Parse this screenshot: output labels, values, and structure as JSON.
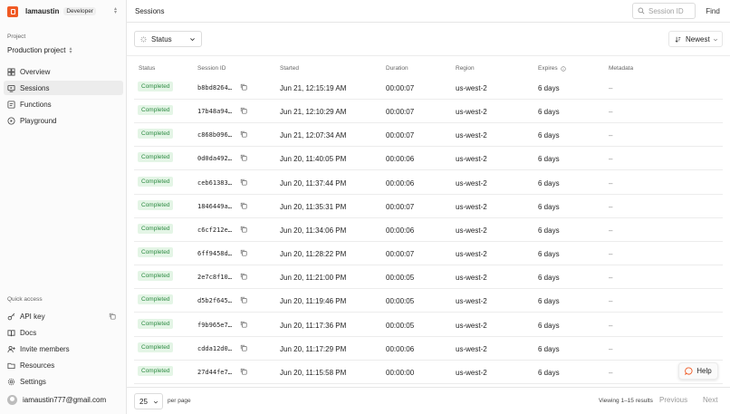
{
  "app": {
    "org_name": "lamaustin",
    "plan_badge": "Developer",
    "project_label": "Project",
    "project_name": "Production project"
  },
  "header": {
    "title": "Sessions",
    "search_placeholder": "Session ID",
    "find_label": "Find"
  },
  "nav": {
    "items": [
      {
        "label": "Overview",
        "icon": "overview-icon"
      },
      {
        "label": "Sessions",
        "icon": "sessions-icon",
        "active": true
      },
      {
        "label": "Functions",
        "icon": "functions-icon"
      },
      {
        "label": "Playground",
        "icon": "playground-icon"
      }
    ]
  },
  "quick_access": {
    "label": "Quick access",
    "items": [
      {
        "label": "API key",
        "icon": "key-icon"
      },
      {
        "label": "Docs",
        "icon": "book-icon"
      },
      {
        "label": "Invite members",
        "icon": "user-plus-icon"
      },
      {
        "label": "Resources",
        "icon": "folder-icon"
      },
      {
        "label": "Settings",
        "icon": "gear-icon"
      }
    ]
  },
  "user": {
    "email": "iamaustin777@gmail.com"
  },
  "toolbar": {
    "status_filter": "Status",
    "sort": "Newest"
  },
  "table": {
    "columns": [
      "Status",
      "Session ID",
      "Started",
      "Duration",
      "Region",
      "Expires",
      "Metadata"
    ],
    "rows": [
      {
        "status": "Completed",
        "id": "b8bd8264…",
        "started": "Jun 21, 12:15:19 AM",
        "duration": "00:00:07",
        "region": "us-west-2",
        "expires": "6 days",
        "metadata": "–"
      },
      {
        "status": "Completed",
        "id": "17b48a94…",
        "started": "Jun 21, 12:10:29 AM",
        "duration": "00:00:07",
        "region": "us-west-2",
        "expires": "6 days",
        "metadata": "–"
      },
      {
        "status": "Completed",
        "id": "c868b096…",
        "started": "Jun 21, 12:07:34 AM",
        "duration": "00:00:07",
        "region": "us-west-2",
        "expires": "6 days",
        "metadata": "–"
      },
      {
        "status": "Completed",
        "id": "0d0da492…",
        "started": "Jun 20, 11:40:05 PM",
        "duration": "00:00:06",
        "region": "us-west-2",
        "expires": "6 days",
        "metadata": "–"
      },
      {
        "status": "Completed",
        "id": "ceb61383…",
        "started": "Jun 20, 11:37:44 PM",
        "duration": "00:00:06",
        "region": "us-west-2",
        "expires": "6 days",
        "metadata": "–"
      },
      {
        "status": "Completed",
        "id": "1846449a…",
        "started": "Jun 20, 11:35:31 PM",
        "duration": "00:00:07",
        "region": "us-west-2",
        "expires": "6 days",
        "metadata": "–"
      },
      {
        "status": "Completed",
        "id": "c6cf212e…",
        "started": "Jun 20, 11:34:06 PM",
        "duration": "00:00:06",
        "region": "us-west-2",
        "expires": "6 days",
        "metadata": "–"
      },
      {
        "status": "Completed",
        "id": "6ff9458d…",
        "started": "Jun 20, 11:28:22 PM",
        "duration": "00:00:07",
        "region": "us-west-2",
        "expires": "6 days",
        "metadata": "–"
      },
      {
        "status": "Completed",
        "id": "2e7c8f10…",
        "started": "Jun 20, 11:21:00 PM",
        "duration": "00:00:05",
        "region": "us-west-2",
        "expires": "6 days",
        "metadata": "–"
      },
      {
        "status": "Completed",
        "id": "d5b2f645…",
        "started": "Jun 20, 11:19:46 PM",
        "duration": "00:00:05",
        "region": "us-west-2",
        "expires": "6 days",
        "metadata": "–"
      },
      {
        "status": "Completed",
        "id": "f9b965e7…",
        "started": "Jun 20, 11:17:36 PM",
        "duration": "00:00:05",
        "region": "us-west-2",
        "expires": "6 days",
        "metadata": "–"
      },
      {
        "status": "Completed",
        "id": "cdda12d0…",
        "started": "Jun 20, 11:17:29 PM",
        "duration": "00:00:06",
        "region": "us-west-2",
        "expires": "6 days",
        "metadata": "–"
      },
      {
        "status": "Completed",
        "id": "27d44fe7…",
        "started": "Jun 20, 11:15:58 PM",
        "duration": "00:00:00",
        "region": "us-west-2",
        "expires": "6 days",
        "metadata": "–"
      }
    ]
  },
  "footer": {
    "per_page_value": "25",
    "per_page_label": "per page",
    "viewing": "Viewing 1–15 results",
    "previous": "Previous",
    "next": "Next"
  },
  "help": {
    "label": "Help"
  },
  "colors": {
    "brand": "#f05a24",
    "status_completed_bg": "#e4f5e6",
    "status_completed_text": "#2e8b43"
  }
}
